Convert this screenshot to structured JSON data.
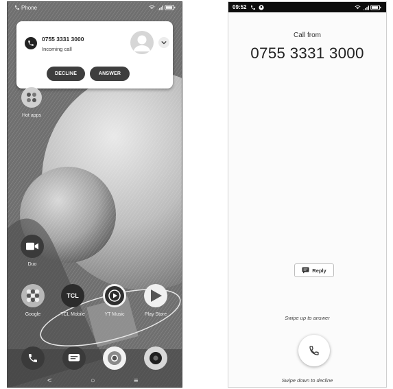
{
  "left_phone": {
    "statusbar": {
      "app_label": "Phone",
      "icons": [
        "phone-icon",
        "wifi-icon",
        "signal-icon",
        "battery-icon"
      ]
    },
    "notification": {
      "number": "0755 3331 3000",
      "subtitle": "Incoming call",
      "decline_label": "DECLINE",
      "answer_label": "ANSWER",
      "icons": [
        "phone-icon",
        "avatar-icon",
        "chevron-down-icon"
      ]
    },
    "apps": {
      "hot_apps": "Hot apps",
      "duo": "Duo",
      "google": "Google",
      "tcl_mobile": "TCL Mobile",
      "tcl_logo": "TCL",
      "yt_music": "YT Music",
      "play_store": "Play Store"
    },
    "dock_icons": [
      "phone-icon",
      "messages-icon",
      "chrome-icon",
      "camera-icon"
    ],
    "nav": {
      "back": "<",
      "home": "○",
      "recents": "≡"
    }
  },
  "right_phone": {
    "statusbar": {
      "time": "09:52",
      "icons": [
        "phone-icon",
        "account-icon",
        "wifi-icon",
        "signal-icon",
        "battery-icon"
      ]
    },
    "call_from": "Call from",
    "number": "0755 3331 3000",
    "reply_label": "Reply",
    "swipe_up": "Swipe up to answer",
    "swipe_down": "Swipe down to decline"
  }
}
